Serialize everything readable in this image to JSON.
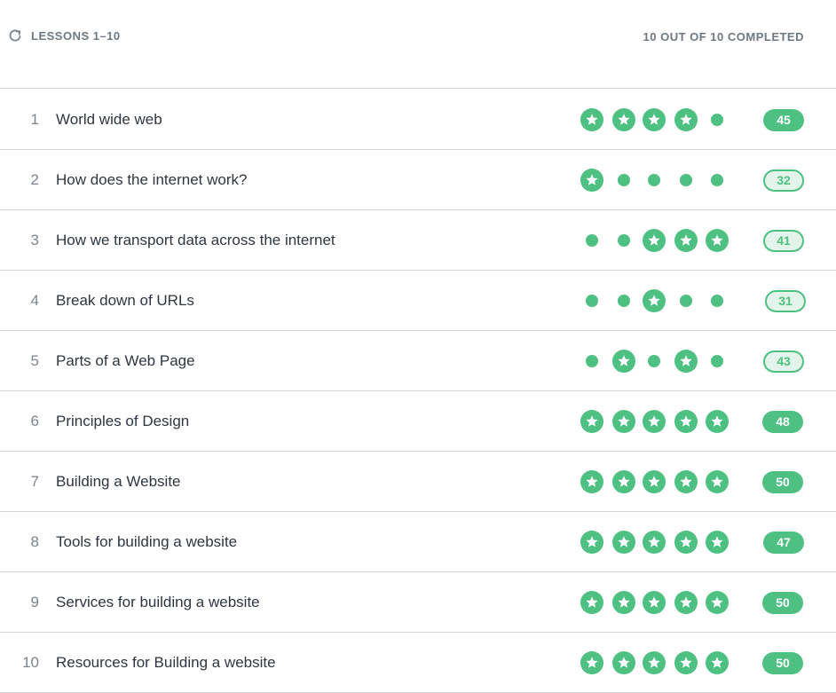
{
  "header": {
    "reset_icon": "refresh-icon",
    "title": "LESSONS 1–10",
    "progress": "10 OUT OF 10 COMPLETED"
  },
  "colors": {
    "accent": "#4ec082",
    "text": "#2f3541",
    "muted": "#6f7782",
    "divider": "#d5d9de"
  },
  "lessons": [
    {
      "number": "1",
      "title": "World wide web",
      "stars": [
        1,
        1,
        1,
        1,
        0
      ],
      "score": "45",
      "score_style": "filled"
    },
    {
      "number": "2",
      "title": "How does the internet work?",
      "stars": [
        1,
        0,
        0,
        0,
        0
      ],
      "score": "32",
      "score_style": "outline"
    },
    {
      "number": "3",
      "title": "How we transport data across the internet",
      "stars": [
        0,
        0,
        1,
        1,
        1
      ],
      "score": "41",
      "score_style": "outline"
    },
    {
      "number": "4",
      "title": "Break down of URLs",
      "stars": [
        0,
        0,
        1,
        0,
        0
      ],
      "score": "31",
      "score_style": "outline"
    },
    {
      "number": "5",
      "title": "Parts of a Web Page",
      "stars": [
        0,
        1,
        0,
        1,
        0
      ],
      "score": "43",
      "score_style": "outline"
    },
    {
      "number": "6",
      "title": "Principles of Design",
      "stars": [
        1,
        1,
        1,
        1,
        1
      ],
      "score": "48",
      "score_style": "filled"
    },
    {
      "number": "7",
      "title": "Building a Website",
      "stars": [
        1,
        1,
        1,
        1,
        1
      ],
      "score": "50",
      "score_style": "filled"
    },
    {
      "number": "8",
      "title": "Tools for building a website",
      "stars": [
        1,
        1,
        1,
        1,
        1
      ],
      "score": "47",
      "score_style": "filled"
    },
    {
      "number": "9",
      "title": "Services for building a website",
      "stars": [
        1,
        1,
        1,
        1,
        1
      ],
      "score": "50",
      "score_style": "filled"
    },
    {
      "number": "10",
      "title": "Resources for Building a website",
      "stars": [
        1,
        1,
        1,
        1,
        1
      ],
      "score": "50",
      "score_style": "filled"
    }
  ]
}
